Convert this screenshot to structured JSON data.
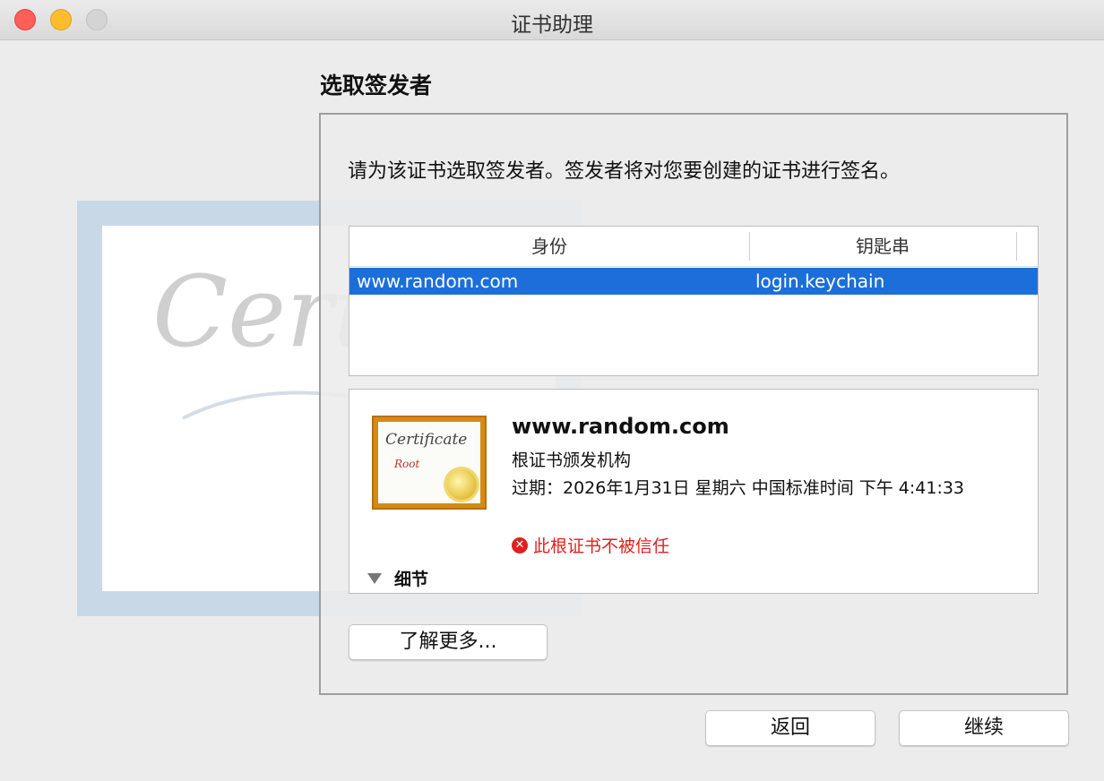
{
  "window": {
    "title": "证书助理"
  },
  "page": {
    "heading": "选取签发者",
    "instruction": "请为该证书选取签发者。签发者将对您要创建的证书进行签名。"
  },
  "table": {
    "columns": [
      "身份",
      "钥匙串"
    ],
    "rows": [
      {
        "identity": "www.random.com",
        "keychain": "login.keychain",
        "selected": true
      }
    ]
  },
  "certificate": {
    "icon": "certificate-root-icon",
    "name": "www.random.com",
    "kind": "根证书颁发机构",
    "expiry": "过期：2026年1月31日 星期六 中国标准时间 下午 4:41:33",
    "warning": "此根证书不被信任",
    "details_label": "细节"
  },
  "buttons": {
    "learn_more": "了解更多...",
    "back": "返回",
    "continue": "继续"
  },
  "colors": {
    "selection": "#1c6fd8",
    "warning": "#e02020"
  }
}
